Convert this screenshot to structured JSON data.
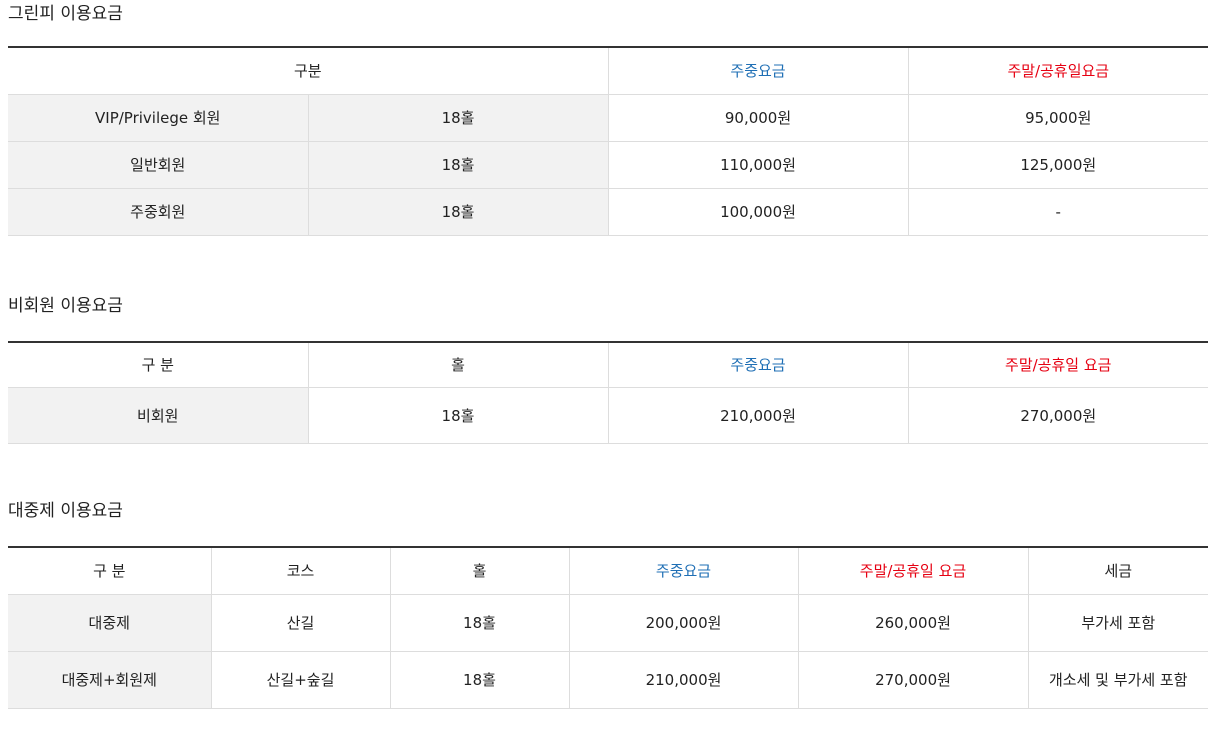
{
  "greenfee": {
    "title": "그린피 이용요금",
    "headers": {
      "category": "구분",
      "weekday": "주중요금",
      "weekend": "주말/공휴일요금"
    },
    "rows": [
      {
        "type": "VIP/Privilege 회원",
        "holes": "18홀",
        "weekday": "90,000원",
        "weekend": "95,000원"
      },
      {
        "type": "일반회원",
        "holes": "18홀",
        "weekday": "110,000원",
        "weekend": "125,000원"
      },
      {
        "type": "주중회원",
        "holes": "18홀",
        "weekday": "100,000원",
        "weekend": "-"
      }
    ]
  },
  "nonmember": {
    "title": "비회원 이용요금",
    "headers": {
      "category": "구 분",
      "holes": "홀",
      "weekday": "주중요금",
      "weekend": "주말/공휴일 요금"
    },
    "rows": [
      {
        "type": "비회원",
        "holes": "18홀",
        "weekday": "210,000원",
        "weekend": "270,000원"
      }
    ]
  },
  "public": {
    "title": "대중제 이용요금",
    "headers": {
      "category": "구 분",
      "course": "코스",
      "holes": "홀",
      "weekday": "주중요금",
      "weekend": "주말/공휴일 요금",
      "tax": "세금"
    },
    "rows": [
      {
        "type": "대중제",
        "course": "산길",
        "holes": "18홀",
        "weekday": "200,000원",
        "weekend": "260,000원",
        "tax": "부가세 포함"
      },
      {
        "type": "대중제+회원제",
        "course": "산길+숲길",
        "holes": "18홀",
        "weekday": "210,000원",
        "weekend": "270,000원",
        "tax": "개소세 및 부가세 포함"
      }
    ]
  },
  "colors": {
    "weekday": "#1f6fb5",
    "weekend": "#e60012",
    "row_header_bg": "#f2f2f2"
  }
}
